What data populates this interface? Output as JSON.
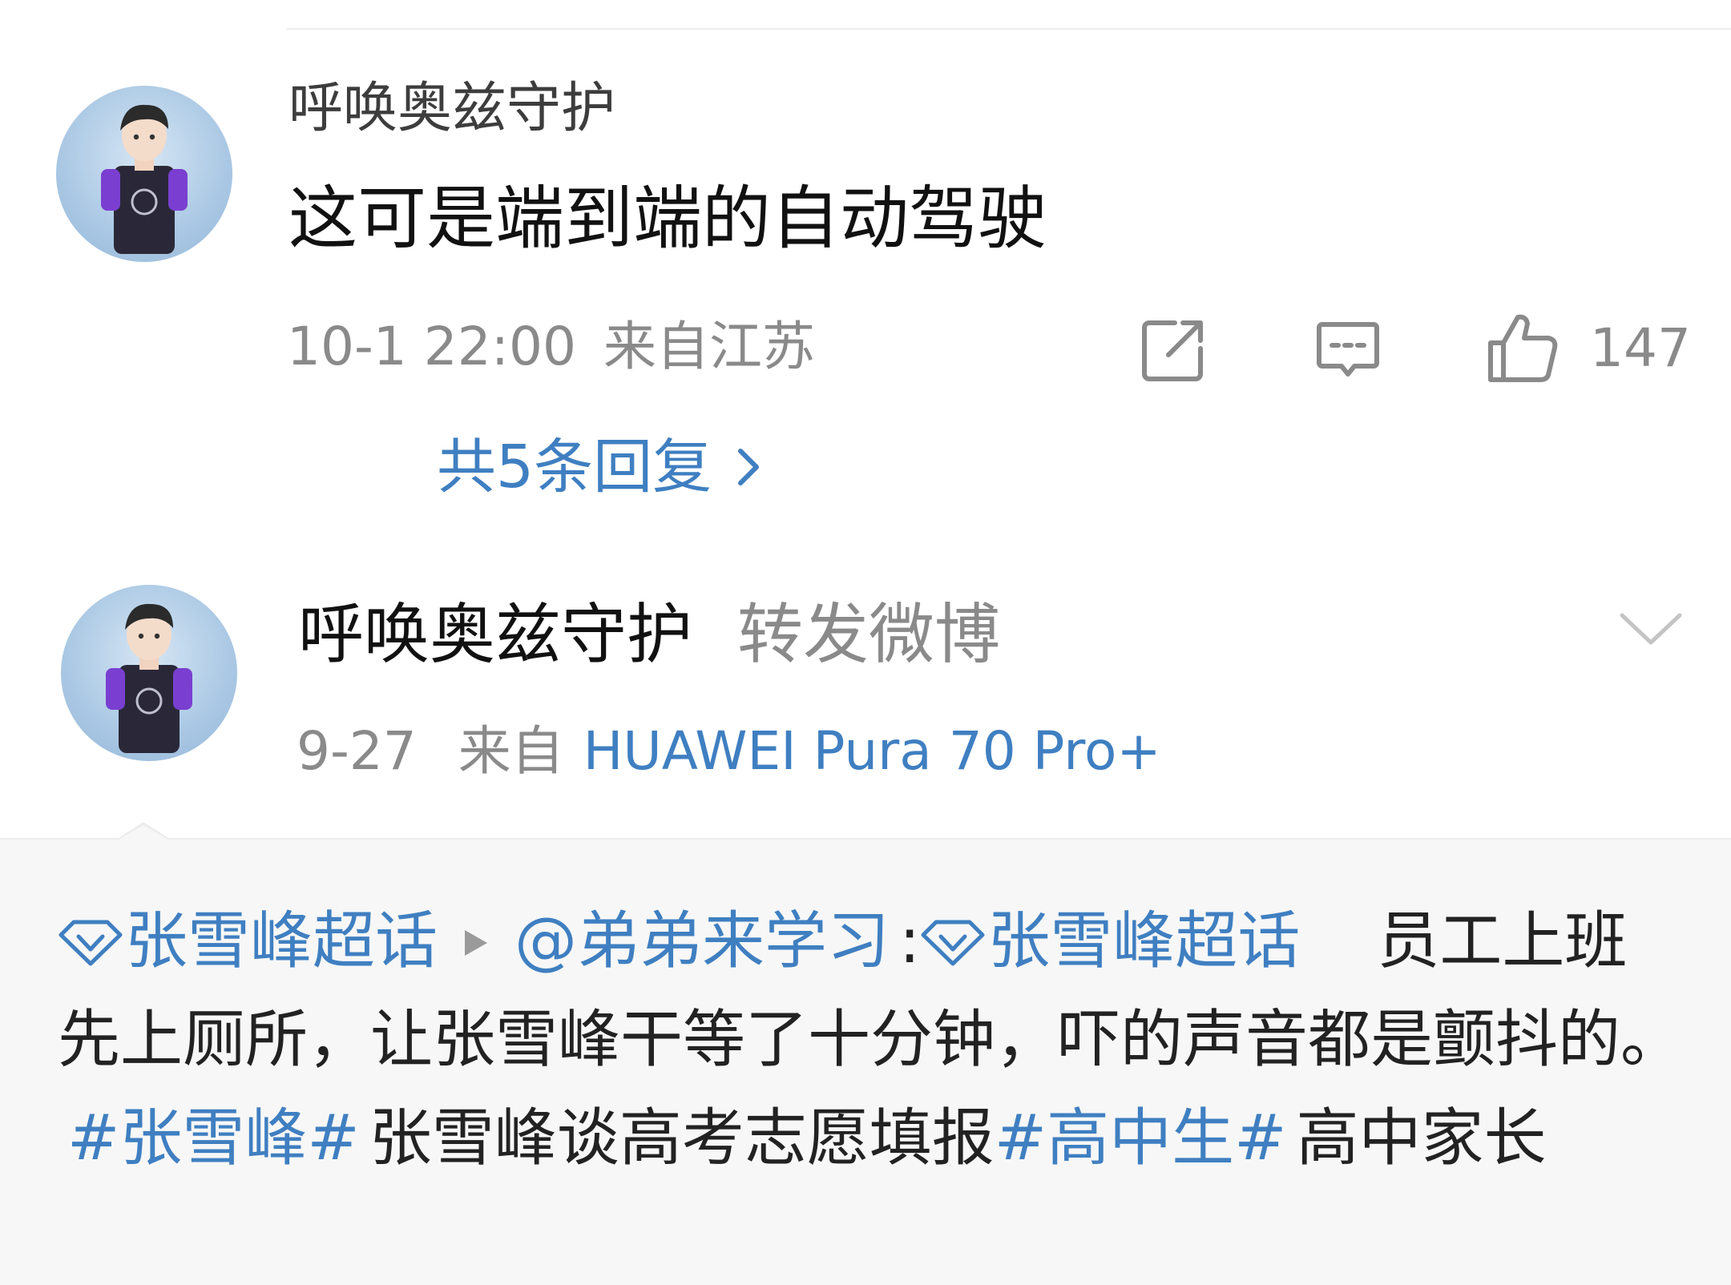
{
  "comment": {
    "username": "呼唤奥兹守护",
    "text": "这可是端到端的自动驾驶",
    "date": "10-1 22:00",
    "location": "来自江苏",
    "like_count": "147",
    "replies_label": "共5条回复",
    "replies_chevron": "›"
  },
  "repost": {
    "username": "呼唤奥兹守护",
    "action": "转发微博",
    "date": "9-27",
    "source_label": "来自",
    "device": "HUAWEI Pura 70 Pro+",
    "topic_1": "张雪峰超话",
    "mention": "@弟弟来学习",
    "colon": ":",
    "topic_2": "张雪峰超话",
    "body_1": "员工上班先上厕所，让张雪峰干等了十分钟，吓的声音都是颤抖的。",
    "hashtag_1": "#张雪峰#",
    "body_2": "张雪峰谈高考志愿填报",
    "hashtag_2": "#高中生#",
    "body_3": "高中家长"
  },
  "icons": {
    "share": "share-icon",
    "comment": "comment-icon",
    "like": "thumbs-up-icon",
    "dropdown": "chevron-down-icon",
    "topic": "diamond-icon"
  },
  "colors": {
    "link_blue": "#3f7fc1",
    "meta_gray": "#8a8a8a",
    "repost_bg": "#f7f7f7"
  }
}
